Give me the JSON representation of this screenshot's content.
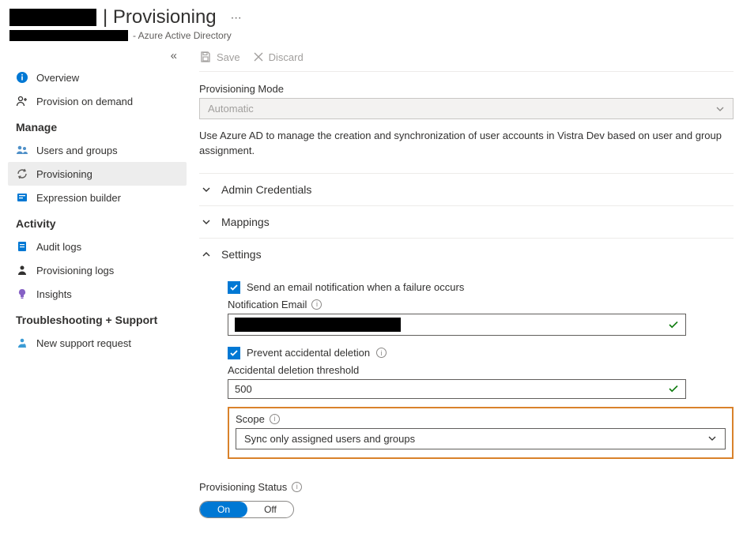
{
  "header": {
    "title_separator": "|",
    "title": "Provisioning",
    "subtitle": "- Azure Active Directory"
  },
  "toolbar": {
    "save": "Save",
    "discard": "Discard"
  },
  "sidebar": {
    "collapse_glyph": "«",
    "items": [
      {
        "label": "Overview",
        "icon": "info-icon"
      },
      {
        "label": "Provision on demand",
        "icon": "person-plus-icon"
      }
    ],
    "manage_heading": "Manage",
    "manage": [
      {
        "label": "Users and groups",
        "icon": "users-icon"
      },
      {
        "label": "Provisioning",
        "icon": "sync-icon",
        "active": true
      },
      {
        "label": "Expression builder",
        "icon": "builder-icon"
      }
    ],
    "activity_heading": "Activity",
    "activity": [
      {
        "label": "Audit logs",
        "icon": "audit-icon"
      },
      {
        "label": "Provisioning logs",
        "icon": "log-icon"
      },
      {
        "label": "Insights",
        "icon": "insights-icon"
      }
    ],
    "troubleshoot_heading": "Troubleshooting + Support",
    "troubleshoot": [
      {
        "label": "New support request",
        "icon": "support-icon"
      }
    ]
  },
  "form": {
    "mode_label": "Provisioning Mode",
    "mode_value": "Automatic",
    "description": "Use Azure AD to manage the creation and synchronization of user accounts in Vistra Dev based on user and group assignment."
  },
  "sections": {
    "admin": "Admin Credentials",
    "mappings": "Mappings",
    "settings": "Settings"
  },
  "settings": {
    "send_email_label": "Send an email notification when a failure occurs",
    "send_email_checked": true,
    "notification_email_label": "Notification Email",
    "prevent_delete_label": "Prevent accidental deletion",
    "prevent_delete_checked": true,
    "threshold_label": "Accidental deletion threshold",
    "threshold_value": "500",
    "scope_label": "Scope",
    "scope_value": "Sync only assigned users and groups"
  },
  "status": {
    "label": "Provisioning Status",
    "on": "On",
    "off": "Off",
    "value": "On"
  }
}
